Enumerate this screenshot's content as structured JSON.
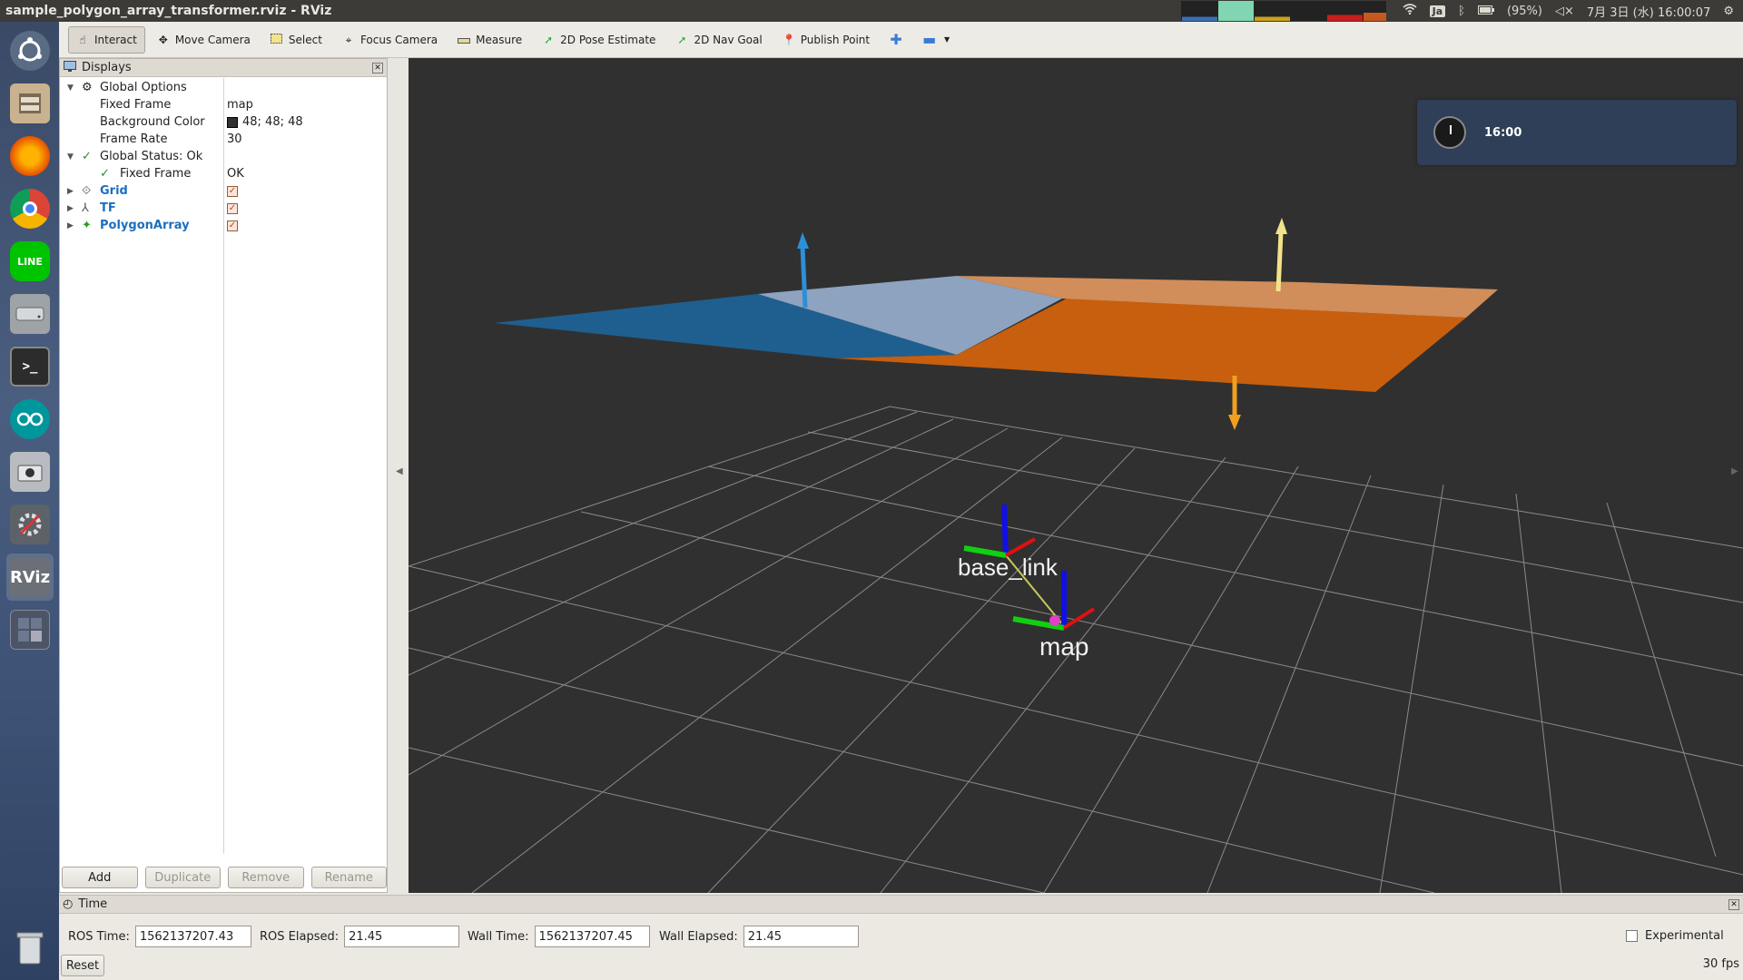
{
  "window": {
    "title": "sample_polygon_array_transformer.rviz - RViz"
  },
  "tray": {
    "battery": "(95%)",
    "datetime": "7月 3日 (水) 16:00:07",
    "ime": "Ja"
  },
  "toolbar": {
    "tools": [
      {
        "label": "Interact",
        "icon": "hand-icon"
      },
      {
        "label": "Move Camera",
        "icon": "move-icon"
      },
      {
        "label": "Select",
        "icon": "select-icon"
      },
      {
        "label": "Focus Camera",
        "icon": "focus-icon"
      },
      {
        "label": "Measure",
        "icon": "ruler-icon"
      },
      {
        "label": "2D Pose Estimate",
        "icon": "pose-arrow-icon"
      },
      {
        "label": "2D Nav Goal",
        "icon": "nav-arrow-icon"
      },
      {
        "label": "Publish Point",
        "icon": "pin-icon"
      }
    ]
  },
  "displays": {
    "header": "Displays",
    "global_options": "Global Options",
    "fixed_frame_key": "Fixed Frame",
    "fixed_frame_val": "map",
    "bg_color_key": "Background Color",
    "bg_color_val": "48; 48; 48",
    "frame_rate_key": "Frame Rate",
    "frame_rate_val": "30",
    "global_status": "Global Status: Ok",
    "status_fixed_frame_key": "Fixed Frame",
    "status_fixed_frame_val": "OK",
    "grid": "Grid",
    "tf": "TF",
    "polygon_array": "PolygonArray",
    "buttons": {
      "add": "Add",
      "duplicate": "Duplicate",
      "remove": "Remove",
      "rename": "Rename"
    }
  },
  "view3d": {
    "background": "#303030",
    "frame_labels": {
      "base_link": "base_link",
      "map": "map"
    },
    "polygon_colors": {
      "blue": "#1f5f8f",
      "orange": "#c75f0e"
    }
  },
  "notification": {
    "time": "16:00"
  },
  "time_panel": {
    "header": "Time",
    "ros_time_label": "ROS Time:",
    "ros_time": "1562137207.43",
    "ros_elapsed_label": "ROS Elapsed:",
    "ros_elapsed": "21.45",
    "wall_time_label": "Wall Time:",
    "wall_time": "1562137207.45",
    "wall_elapsed_label": "Wall Elapsed:",
    "wall_elapsed": "21.45",
    "experimental": "Experimental",
    "reset": "Reset",
    "fps": "30 fps"
  }
}
